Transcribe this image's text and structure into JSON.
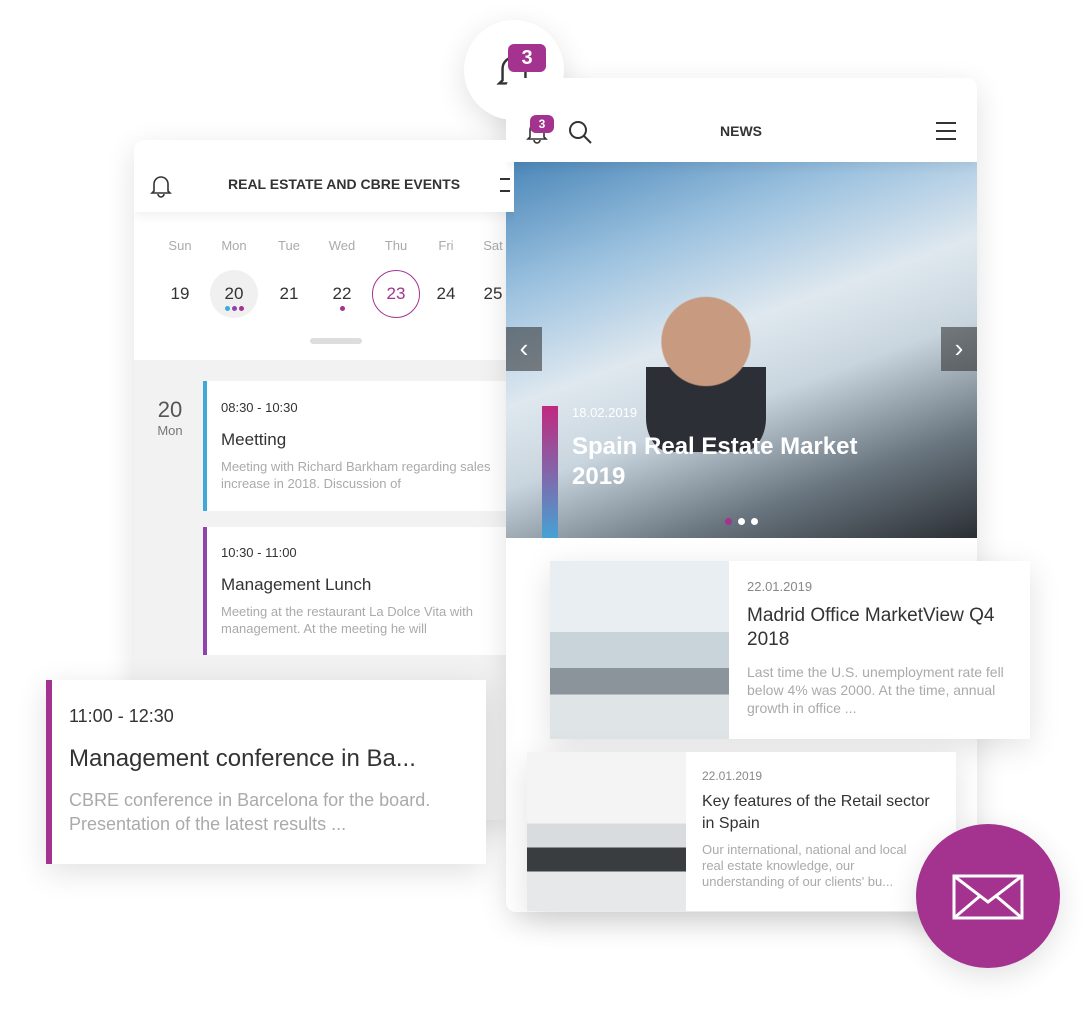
{
  "notification": {
    "count": "3",
    "icon": "bell-icon"
  },
  "calendar": {
    "title": "REAL ESTATE AND CBRE EVENTS",
    "days": [
      {
        "name": "Sun",
        "num": "19"
      },
      {
        "name": "Mon",
        "num": "20"
      },
      {
        "name": "Tue",
        "num": "21"
      },
      {
        "name": "Wed",
        "num": "22"
      },
      {
        "name": "Thu",
        "num": "23"
      },
      {
        "name": "Fri",
        "num": "24"
      },
      {
        "name": "Sat",
        "num": "25"
      }
    ],
    "selected_day": "20",
    "today": "23",
    "day_label": {
      "num": "20",
      "name": "Mon"
    },
    "events": [
      {
        "time": "08:30 - 10:30",
        "title": "Meetting",
        "desc": "Meeting with Richard Barkham regarding sales increase in 2018. Discussion of",
        "color": "#3fa9d9"
      },
      {
        "time": "10:30 - 11:00",
        "title": "Management Lunch",
        "desc": "Meeting at the restaurant La Dolce Vita with management. At the meeting he will",
        "color": "#8e44ad"
      }
    ],
    "featured_event": {
      "time": "11:00 - 12:30",
      "title": "Management conference in Ba...",
      "desc": "CBRE conference in Barcelona for the board. Presentation of the latest results ...",
      "color": "#a3338f"
    }
  },
  "news": {
    "title": "NEWS",
    "badge": "3",
    "hero": {
      "date": "18.02.2019",
      "title": "Spain Real Estate Market 2019",
      "slides": 3,
      "active_slide": 1
    },
    "articles": [
      {
        "date": "22.01.2019",
        "title": "Madrid Office MarketView Q4 2018",
        "desc": "Last time the U.S. unemployment rate fell below 4% was 2000. At the time, annual growth in office ..."
      },
      {
        "date": "22.01.2019",
        "title": "Key features of the Retail sector in Spain",
        "desc": "Our international, national and local real estate knowledge, our understanding of our clients' bu..."
      }
    ]
  },
  "colors": {
    "accent": "#a3338f",
    "blue": "#3fa9d9",
    "purple": "#8e44ad"
  },
  "mail": {
    "icon": "mail-icon"
  }
}
